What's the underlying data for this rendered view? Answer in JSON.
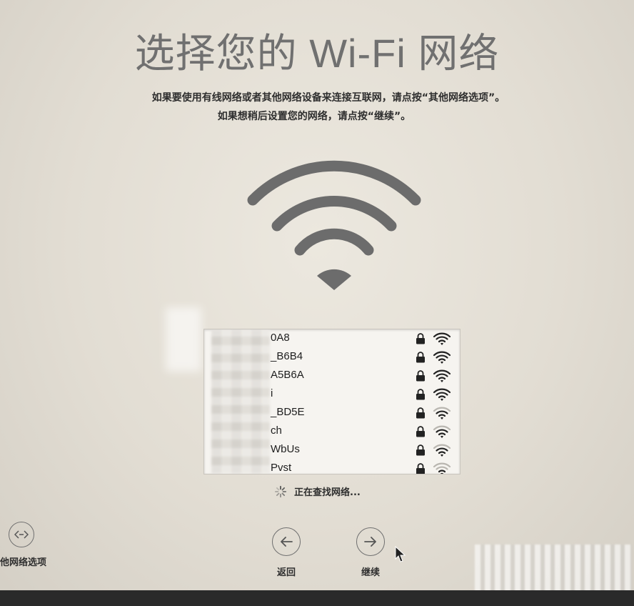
{
  "title": "选择您的 Wi-Fi 网络",
  "instructions": {
    "line1": "如果要使用有线网络或者其他网络设备来连接互联网，请点按“其他网络选项”。",
    "line2": "如果想稍后设置您的网络，请点按“继续”。"
  },
  "networks": [
    {
      "name": "0A8",
      "locked": true,
      "signal": 4
    },
    {
      "name": "_B6B4",
      "locked": true,
      "signal": 4
    },
    {
      "name": "A5B6A",
      "locked": true,
      "signal": 4
    },
    {
      "name": "i",
      "locked": true,
      "signal": 4
    },
    {
      "name": "_BD5E",
      "locked": true,
      "signal": 3
    },
    {
      "name": "ch",
      "locked": true,
      "signal": 3
    },
    {
      "name": "WbUs",
      "locked": true,
      "signal": 3
    },
    {
      "name": "Pvst",
      "locked": true,
      "signal": 2
    }
  ],
  "status": {
    "searching_text": "正在查找网络..."
  },
  "buttons": {
    "other_network_label": "他网络选项",
    "back_label": "返回",
    "continue_label": "继续"
  },
  "icons": {
    "wifi_large": "wifi-icon",
    "lock": "lock-icon",
    "signal": "wifi-signal-icon",
    "spinner": "loading-spinner-icon",
    "back": "arrow-left-icon",
    "next": "arrow-right-icon",
    "other": "network-options-icon",
    "cursor": "mouse-cursor-icon"
  },
  "colors": {
    "accent": "#707070",
    "background": "#e6e2d9"
  }
}
